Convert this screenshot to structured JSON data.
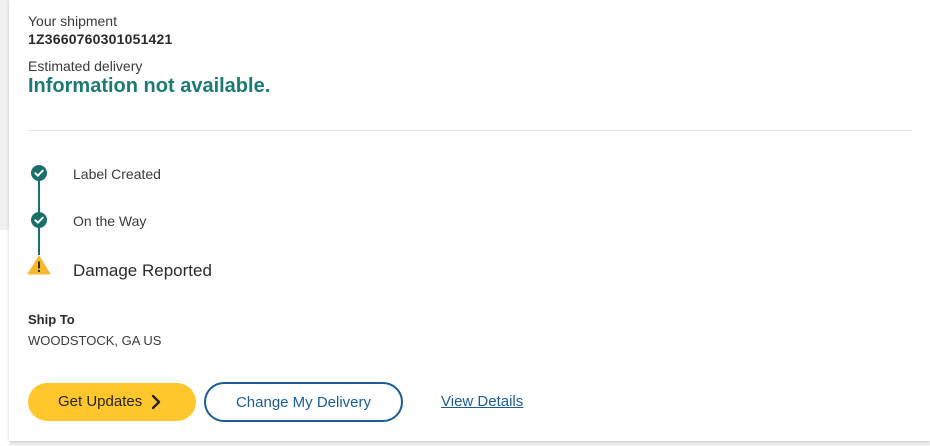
{
  "shipment": {
    "heading": "Your shipment",
    "tracking_number": "1Z3660760301051421",
    "estimated_label": "Estimated delivery",
    "estimated_value": "Information not available."
  },
  "timeline": {
    "steps": [
      {
        "label": "Label Created",
        "status": "complete",
        "icon": "check-circle-icon"
      },
      {
        "label": "On the Way",
        "status": "complete",
        "icon": "check-circle-icon"
      },
      {
        "label": "Damage Reported",
        "status": "alert",
        "icon": "warning-icon"
      }
    ]
  },
  "ship_to": {
    "label": "Ship To",
    "value": "WOODSTOCK, GA US"
  },
  "actions": {
    "get_updates": "Get Updates",
    "change_delivery": "Change My Delivery",
    "view_details": "View Details"
  },
  "colors": {
    "accent_teal": "#1b7b74",
    "button_yellow": "#ffc72c",
    "link_blue": "#1a5c96",
    "warning_yellow": "#f5b82e"
  }
}
